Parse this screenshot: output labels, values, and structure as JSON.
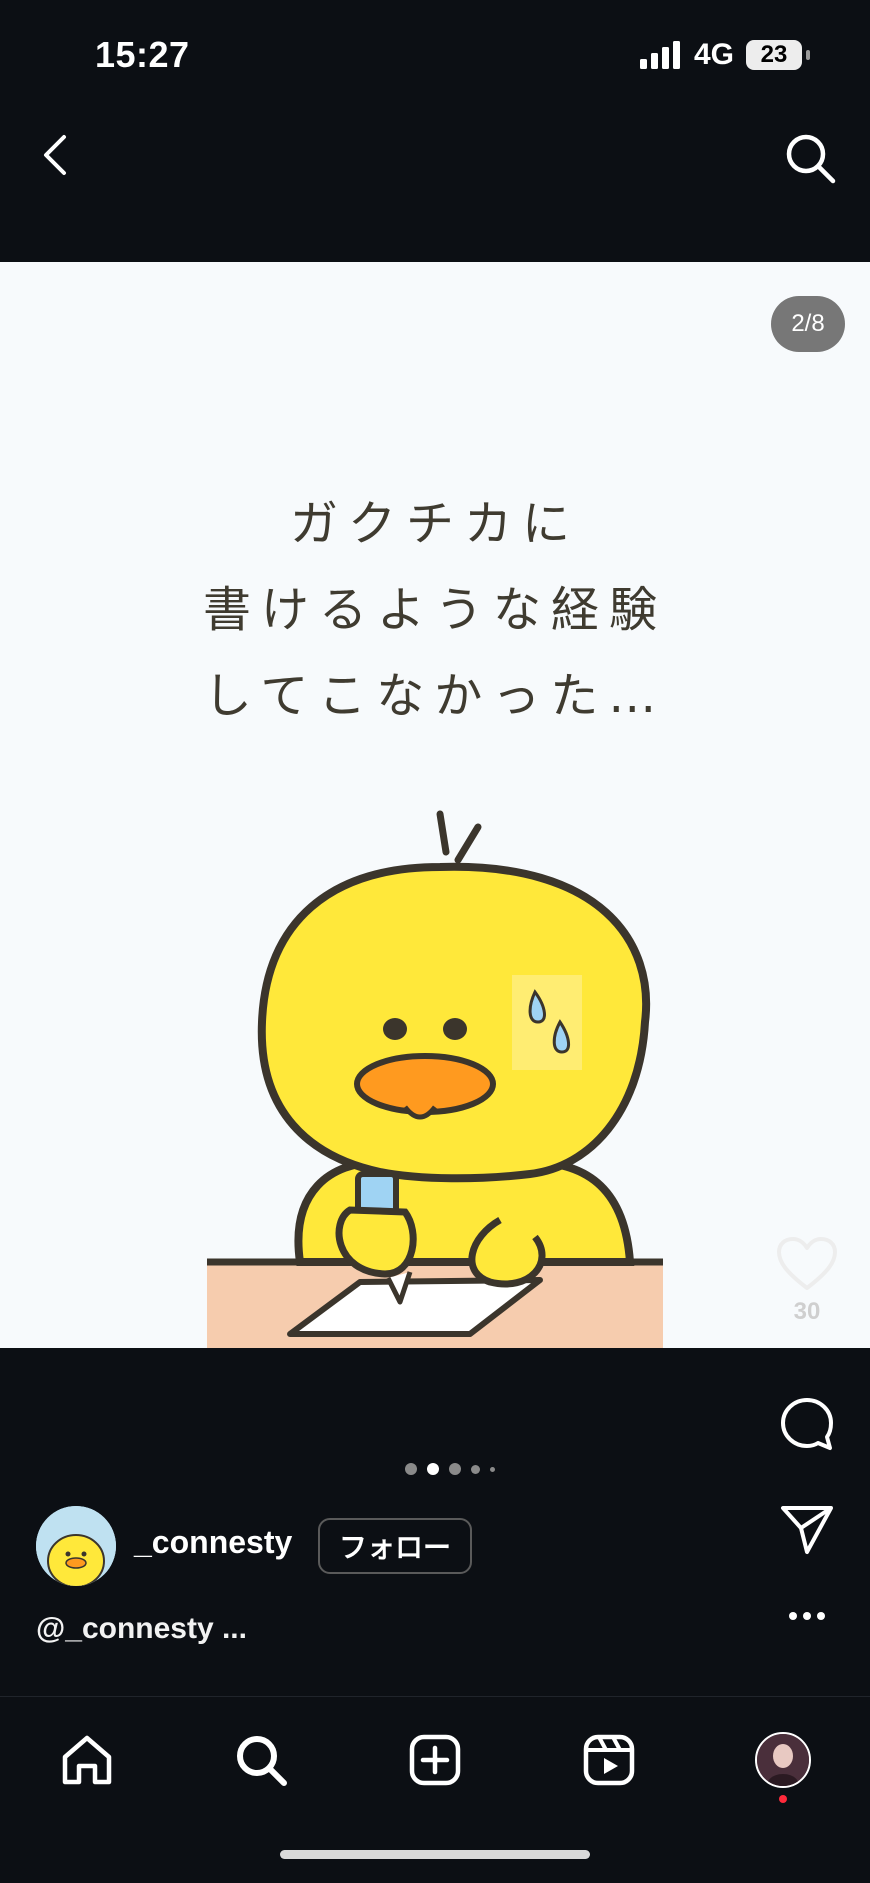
{
  "status_bar": {
    "time": "15:27",
    "network": "4G",
    "battery": "23"
  },
  "post": {
    "counter": "2/8",
    "text_lines": [
      "ガクチカに",
      "書けるような経験",
      "してこなかった…"
    ]
  },
  "actions": {
    "like_count": "30"
  },
  "carousel": {
    "total_dots": 5,
    "active_index": 1
  },
  "author": {
    "username": "_connesty",
    "follow_label": "フォロー"
  },
  "caption": {
    "text": "@_connesty ..."
  },
  "colors": {
    "background": "#0c0f14",
    "chick_yellow": "#ffe83a",
    "beak_orange": "#ff9a1f",
    "desk": "#f6ccae",
    "text": "#3f3b30"
  },
  "icons": {
    "nav": [
      "back-icon",
      "search-icon"
    ],
    "rail": [
      "heart-icon",
      "comment-icon",
      "send-icon",
      "more-icon"
    ],
    "tabs": [
      "home-icon",
      "explore-icon",
      "create-icon",
      "reels-icon",
      "profile-avatar"
    ]
  }
}
